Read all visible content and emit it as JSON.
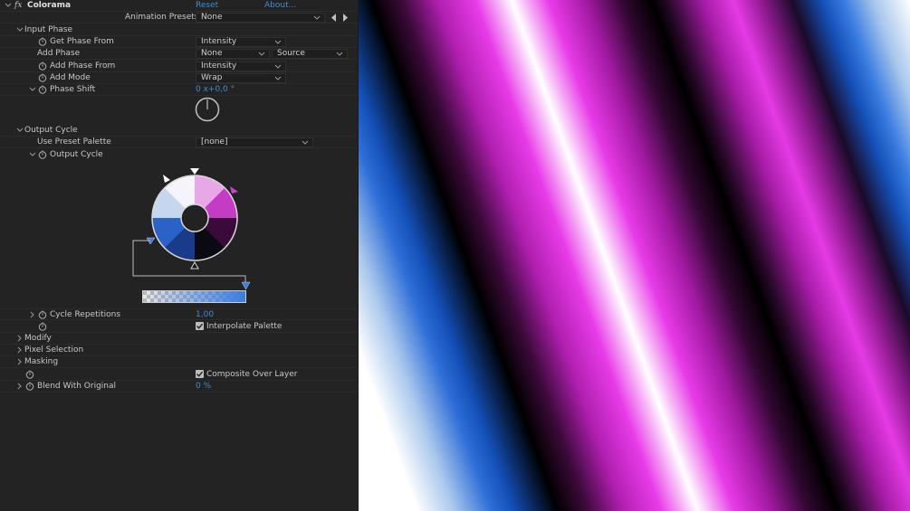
{
  "effect": {
    "fx_glyph": "fx",
    "name": "Colorama",
    "reset_label": "Reset",
    "about_label": "About...",
    "presets_label": "Animation Presets:",
    "presets_value": "None"
  },
  "input_phase": {
    "label": "Input Phase",
    "get_phase_from": {
      "label": "Get Phase From",
      "value": "Intensity"
    },
    "add_phase": {
      "label": "Add Phase",
      "value": "None",
      "source_value": "Source"
    },
    "add_phase_from": {
      "label": "Add Phase From",
      "value": "Intensity"
    },
    "add_mode": {
      "label": "Add Mode",
      "value": "Wrap"
    },
    "phase_shift": {
      "label": "Phase Shift",
      "value": "0 x+0,0 °"
    }
  },
  "output_cycle": {
    "label": "Output Cycle",
    "use_preset_palette": {
      "label": "Use Preset Palette",
      "value": "[none]"
    },
    "output_cycle_prop": {
      "label": "Output Cycle"
    },
    "cycle_repetitions": {
      "label": "Cycle Repetitions",
      "value": "1,00"
    },
    "interpolate_palette": {
      "label": "Interpolate Palette",
      "checked": true
    }
  },
  "groups": {
    "modify": "Modify",
    "pixel_selection": "Pixel Selection",
    "masking": "Masking"
  },
  "composite_over_layer": {
    "label": "Composite Over Layer",
    "checked": true
  },
  "blend_with_original": {
    "label": "Blend With Original",
    "value": "0 %"
  },
  "colors": {
    "accent_blue": "#3e8ed0",
    "panel_bg": "#232323",
    "text": "#c8c8c8"
  },
  "icons": {
    "stopwatch": "stopwatch-icon",
    "disclosure": "chevron-icon",
    "dropdown": "chevron-down-icon",
    "preset_prev": "triangle-left-icon",
    "preset_next": "triangle-right-icon"
  }
}
